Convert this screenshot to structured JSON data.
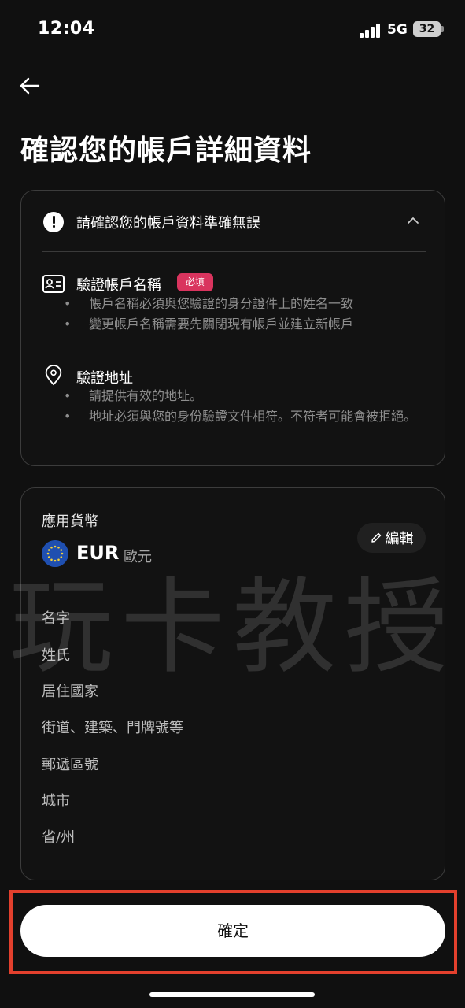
{
  "status_bar": {
    "time": "12:04",
    "network": "5G",
    "battery": "32"
  },
  "header": {
    "back_icon": "arrow-left-icon",
    "title": "確認您的帳戶詳細資料"
  },
  "verification_card": {
    "notice_icon": "exclamation-circle-icon",
    "notice_text": "請確認您的帳戶資料準確無誤",
    "collapse_icon": "chevron-up-icon",
    "account_name": {
      "icon": "id-card-icon",
      "title": "驗證帳戶名稱",
      "badge": "必填",
      "bullets": [
        "帳戶名稱必須與您驗證的身分證件上的姓名一致",
        "變更帳戶名稱需要先關閉現有帳戶並建立新帳戶"
      ]
    },
    "address": {
      "icon": "location-pin-icon",
      "title": "驗證地址",
      "bullets": [
        "請提供有效的地址。",
        "地址必須與您的身份驗證文件相符。不符者可能會被拒絕。"
      ]
    }
  },
  "details_card": {
    "currency_label": "應用貨幣",
    "currency_icon": "eu-flag-icon",
    "currency_code": "EUR",
    "currency_name": "歐元",
    "edit_label": "編輯",
    "edit_icon": "pencil-icon",
    "fields": [
      "名字",
      "姓氏",
      "居住國家",
      "街道、建築、門牌號等",
      "郵遞區號",
      "城市",
      "省/州"
    ]
  },
  "watermark": "玩卡教授",
  "confirm_label": "確定",
  "colors": {
    "background": "#101010",
    "badge": "#d9345e",
    "highlight": "#e3402d",
    "primary_button": "#ffffff"
  }
}
